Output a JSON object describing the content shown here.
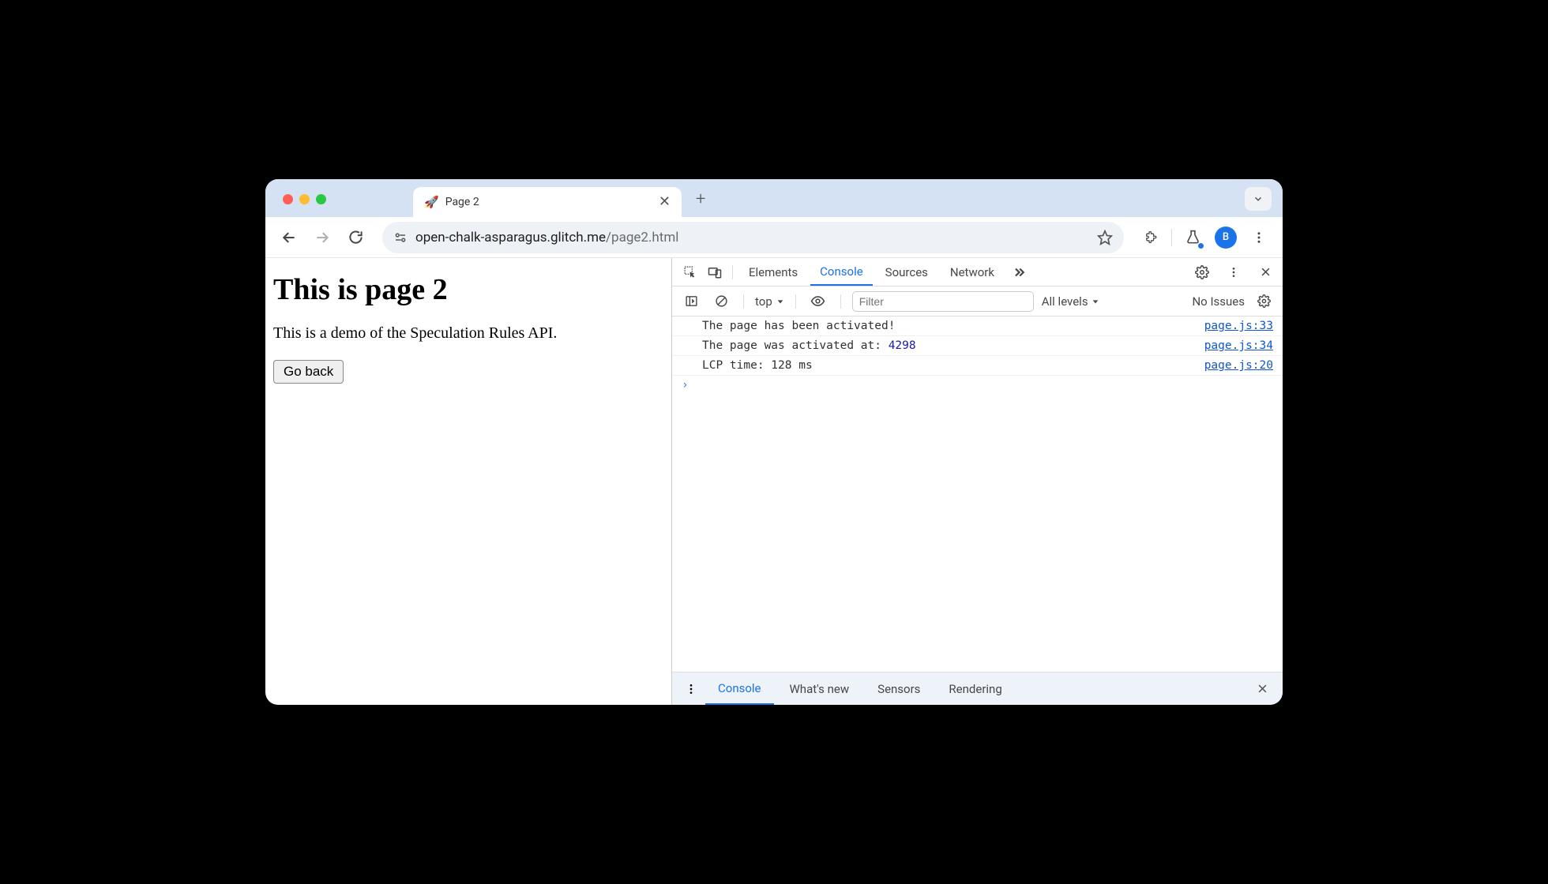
{
  "tab": {
    "icon": "🚀",
    "title": "Page 2"
  },
  "address": {
    "host": "open-chalk-asparagus.glitch.me",
    "path": "/page2.html"
  },
  "avatar": {
    "initial": "B"
  },
  "page": {
    "heading": "This is page 2",
    "paragraph": "This is a demo of the Speculation Rules API.",
    "button": "Go back"
  },
  "devtools": {
    "tabs": [
      "Elements",
      "Console",
      "Sources",
      "Network"
    ],
    "active_tab": "Console",
    "console_toolbar": {
      "context": "top",
      "filter_placeholder": "Filter",
      "levels": "All levels",
      "issues": "No Issues"
    },
    "logs": [
      {
        "text": "The page has been activated!",
        "num": "",
        "link": "page.js:33"
      },
      {
        "text": "The page was activated at: ",
        "num": "4298",
        "link": "page.js:34"
      },
      {
        "text": "LCP time: 128 ms",
        "num": "",
        "link": "page.js:20"
      }
    ],
    "drawer": {
      "tabs": [
        "Console",
        "What's new",
        "Sensors",
        "Rendering"
      ],
      "active": "Console"
    }
  }
}
